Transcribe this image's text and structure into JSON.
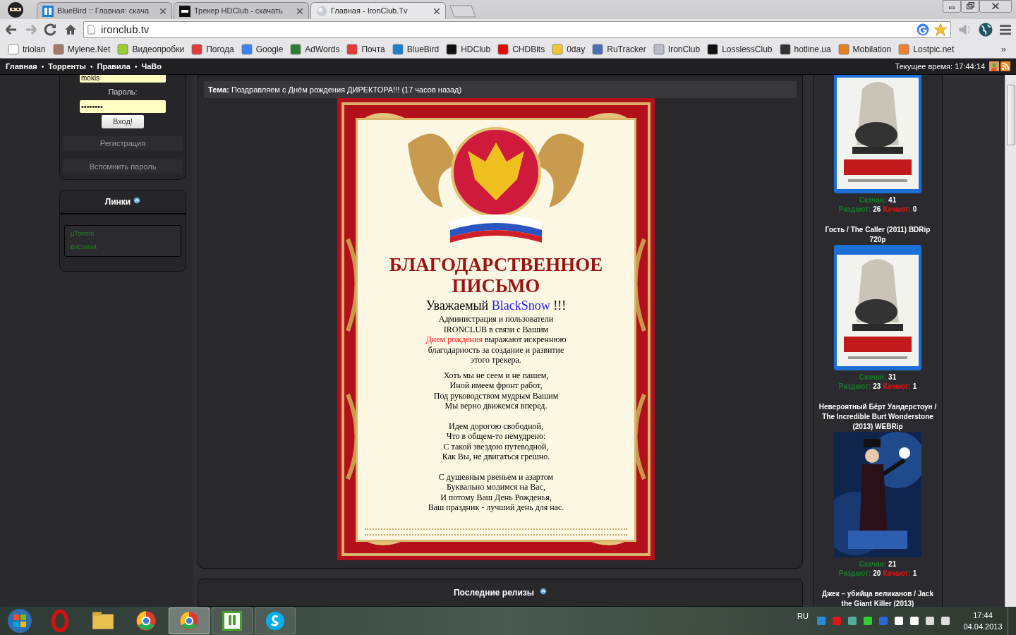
{
  "browser": {
    "tabs": [
      {
        "title": "BlueBird :: Главная: скача",
        "selected": false
      },
      {
        "title": "Трекер HDClub - скачать",
        "selected": false
      },
      {
        "title": "Главная - IronClub.Tv",
        "selected": true
      }
    ],
    "url": "ironclub.tv",
    "bookmarks": [
      "triolan",
      "Mylene.Net",
      "Видеопробки",
      "Погода",
      "Google",
      "AdWords",
      "Почта",
      "BlueBird",
      "HDClub",
      "CHDBits",
      "0day",
      "RuTracker",
      "IronClub",
      "LosslessClub",
      "hotline.ua",
      "Mobilation",
      "Lostpic.net"
    ],
    "overflow": "»"
  },
  "site_nav": {
    "separator": "•",
    "items": [
      "Главная",
      "Торренты",
      "Правила",
      "ЧаВо"
    ],
    "time": "Текущее время: 17:44:14"
  },
  "login": {
    "username": "mokis",
    "password_label": "Пароль:",
    "password": "••••••••",
    "submit": "Вход!",
    "links": [
      "Регистрация",
      "Вспомнить пароль"
    ]
  },
  "links_panel": {
    "title": "Линки",
    "items": [
      "µTorrent",
      "BitComet"
    ]
  },
  "post": {
    "topic_label": "Тема:",
    "topic": "Поздравляем с Днём рождения ДИРЕКТОРА!!! (17 часов назад)",
    "certificate": {
      "title": [
        "БЛАГОДАРСТВЕННОЕ",
        "ПИСЬМО"
      ],
      "greeting": [
        {
          "text": "Уважаемый ",
          "kind": "plain"
        },
        {
          "text": "BlackSnow",
          "kind": "name"
        },
        {
          "text": " !!!",
          "kind": "plain"
        }
      ],
      "stanzas": [
        [
          [
            {
              "text": "Администрация и пользователи",
              "kind": "plain"
            }
          ],
          [
            {
              "text": "IRONCLUB в связи с Вашим",
              "kind": "plain"
            }
          ],
          [
            {
              "text": "Днем рождения",
              "kind": "accent"
            },
            {
              "text": " выражают искреннюю",
              "kind": "plain"
            }
          ],
          [
            {
              "text": "благодарность за создание и развитие",
              "kind": "plain"
            }
          ],
          [
            {
              "text": "этого трекера.",
              "kind": "plain"
            }
          ]
        ],
        [
          [
            {
              "text": "Хоть мы не сеем и не пашем,",
              "kind": "plain"
            }
          ],
          [
            {
              "text": "Иной имеем фронт работ,",
              "kind": "plain"
            }
          ],
          [
            {
              "text": "Под руководством мудрым Вашим",
              "kind": "plain"
            }
          ],
          [
            {
              "text": "Мы верно движемся вперед.",
              "kind": "plain"
            }
          ]
        ],
        [
          [
            {
              "text": "Идем дорогою свободной,",
              "kind": "plain"
            }
          ],
          [
            {
              "text": "Что в общем-то немудрено:",
              "kind": "plain"
            }
          ],
          [
            {
              "text": "С такой звездою путеводной,",
              "kind": "plain"
            }
          ],
          [
            {
              "text": "Как Вы, не двигаться грешно.",
              "kind": "plain"
            }
          ]
        ],
        [
          [
            {
              "text": "С душевным рвеньем и азартом",
              "kind": "plain"
            }
          ],
          [
            {
              "text": "Буквально молимся на Вас,",
              "kind": "plain"
            }
          ],
          [
            {
              "text": "И потому Ваш День Рожденья,",
              "kind": "plain"
            }
          ],
          [
            {
              "text": "Ваш праздник - лучший день для нас.",
              "kind": "plain"
            }
          ]
        ]
      ]
    }
  },
  "latest": {
    "title": "Последние релизы"
  },
  "releases": [
    {
      "stats": {
        "downloaded_label": "Скачан:",
        "downloaded": "41",
        "seeding_label": "Раздают:",
        "seeding": "26",
        "leeching_label": "Качают:",
        "leeching": "0"
      }
    },
    {
      "title": "Гость / The Caller (2011) BDRip 720p",
      "stats": {
        "downloaded_label": "Скачан:",
        "downloaded": "31",
        "seeding_label": "Раздают:",
        "seeding": "23",
        "leeching_label": "Качают:",
        "leeching": "1"
      }
    },
    {
      "title": "Невероятный Бёрт Уандерстоун / The Incredible Burt Wonderstone (2013) WEBRip",
      "stats": {
        "downloaded_label": "Скачан:",
        "downloaded": "21",
        "seeding_label": "Раздают:",
        "seeding": "20",
        "leeching_label": "Качают:",
        "leeching": "1"
      }
    },
    {
      "title": "Джек – убийца великанов / Jack the Giant Killer (2013)"
    }
  ],
  "taskbar": {
    "apps": [
      {
        "selected": false
      },
      {
        "selected": false
      },
      {
        "selected": false
      },
      {
        "selected": true
      },
      {
        "selected": false
      },
      {
        "selected": false
      }
    ],
    "language": "RU",
    "time": "17:44",
    "date": "04.04.2013"
  }
}
